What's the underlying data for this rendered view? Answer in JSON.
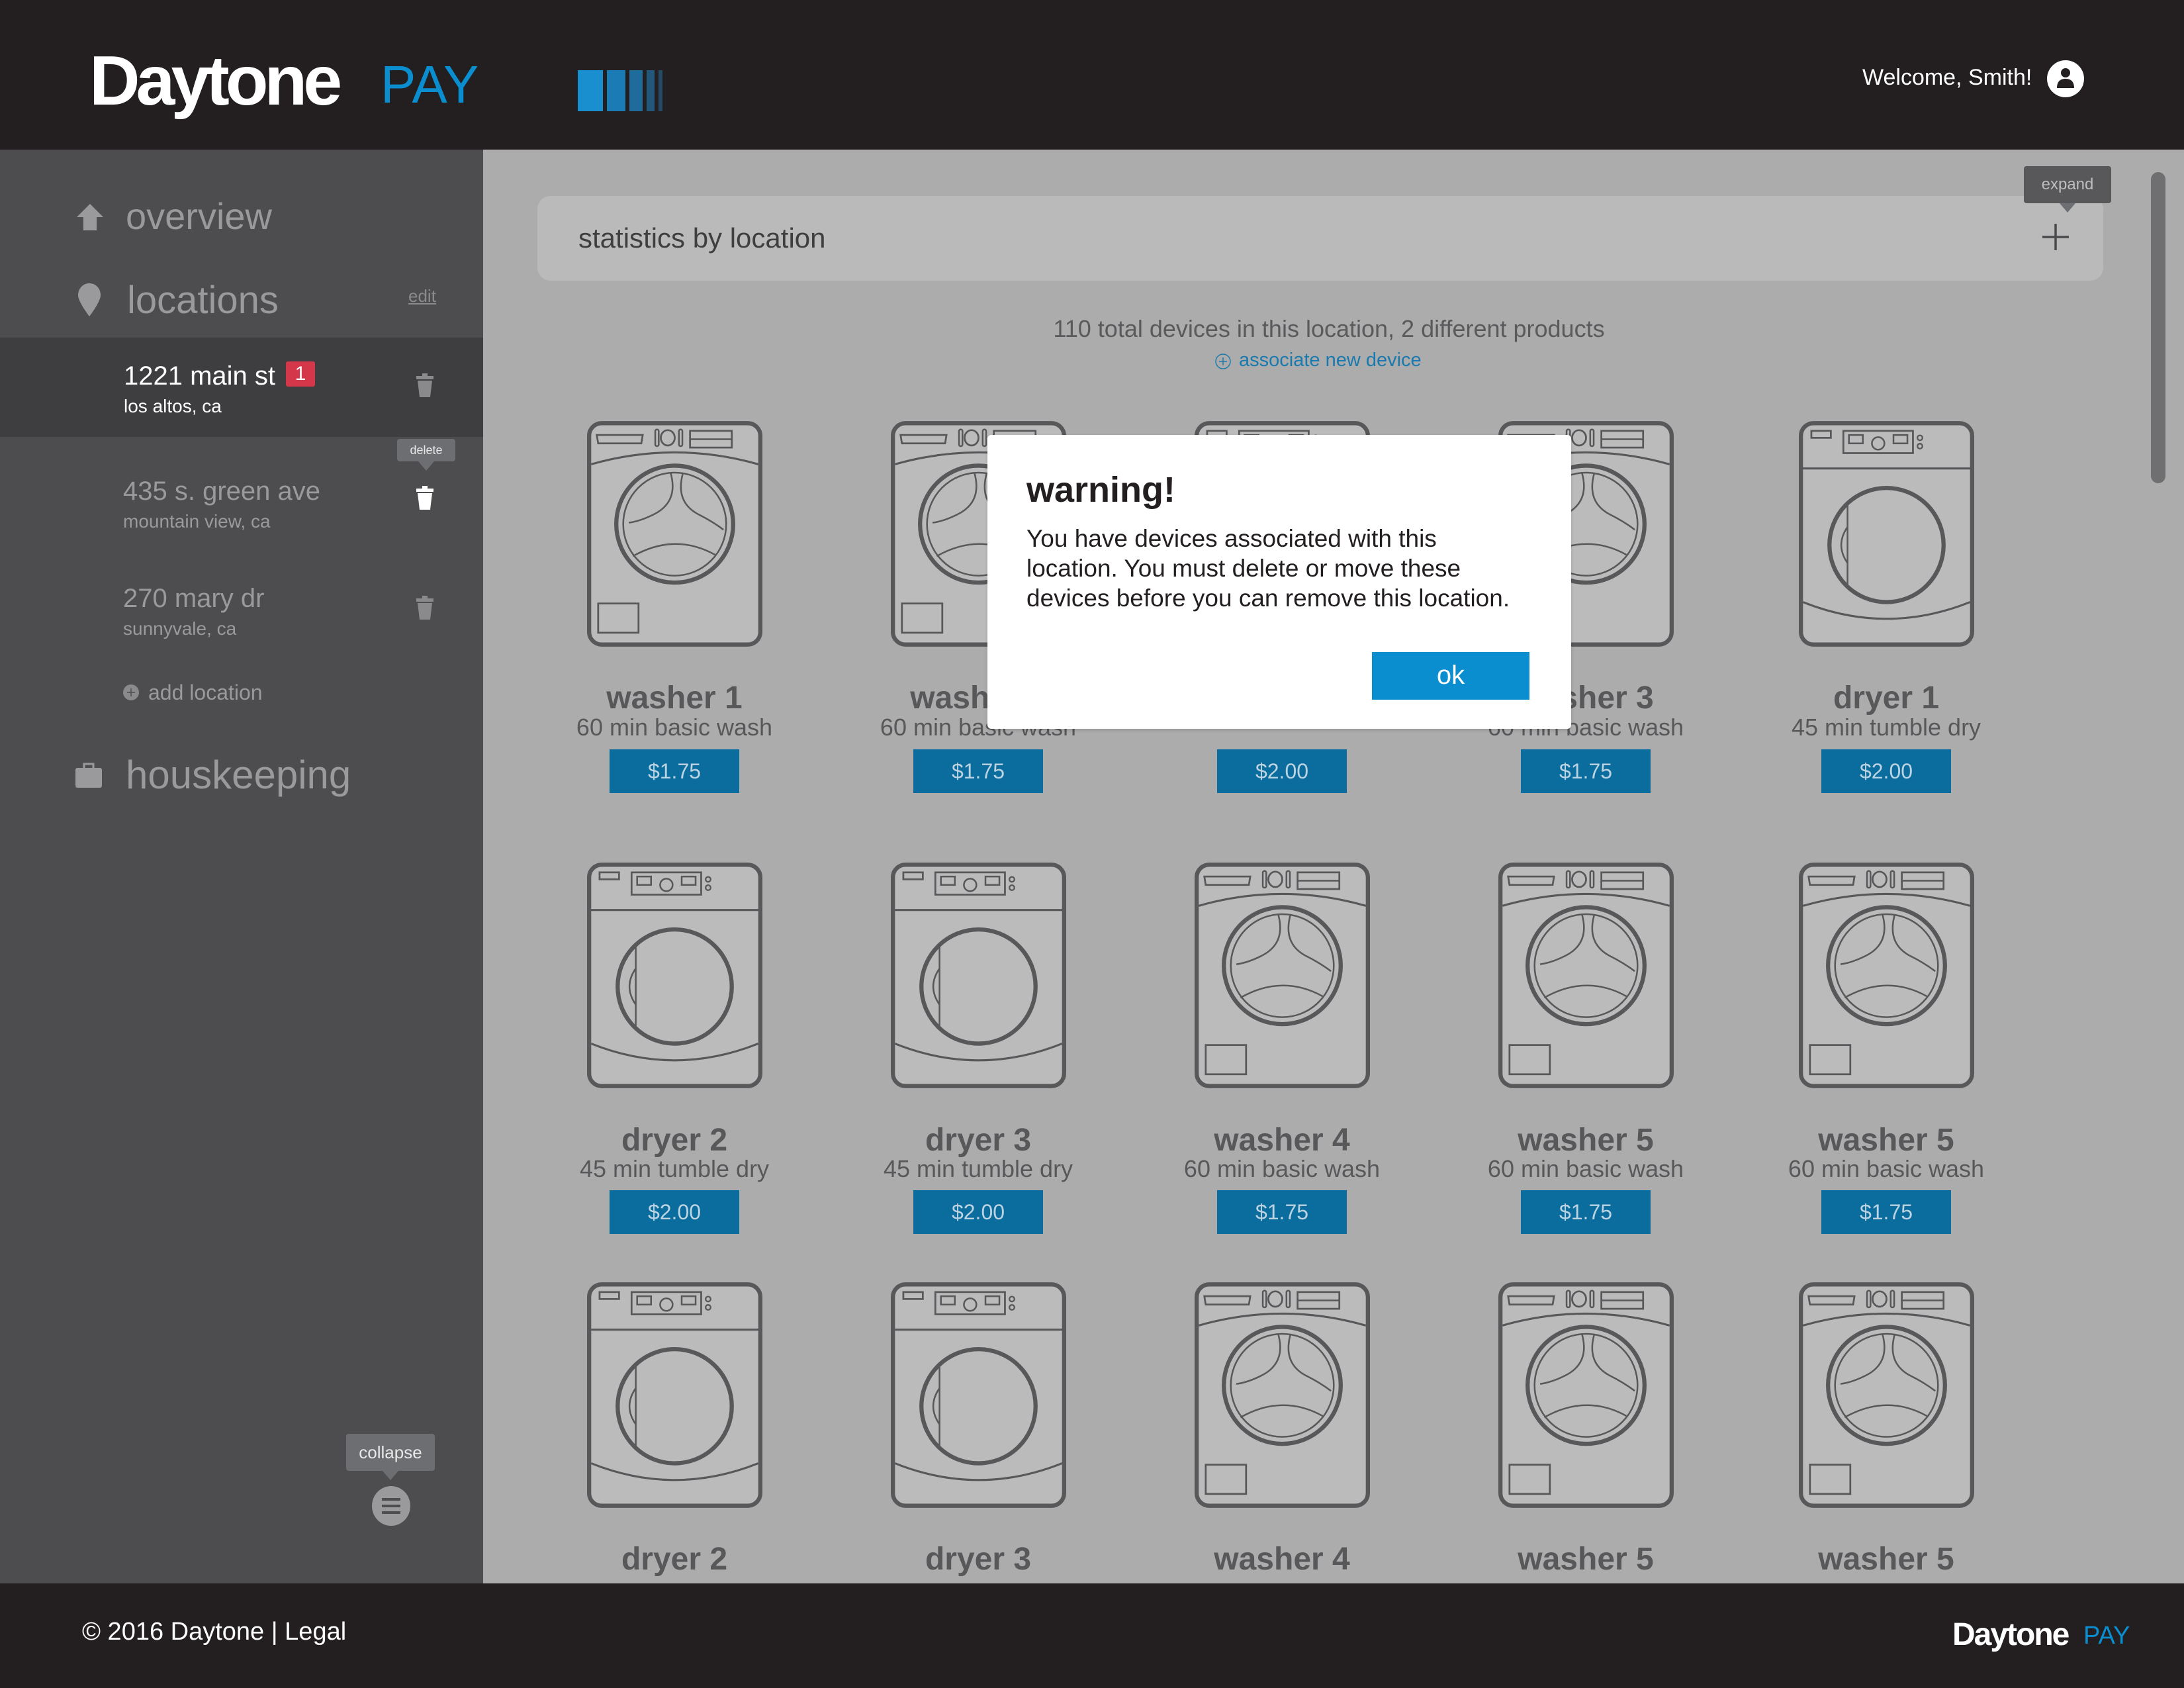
{
  "header": {
    "logo_word": "Daytone",
    "logo_pay": "PAY",
    "welcome": "Welcome, Smith!",
    "avatar_icon": "user-icon"
  },
  "sidebar": {
    "overview": "overview",
    "locations": "locations",
    "edit": "edit",
    "locations_list": [
      {
        "name": "1221 main st",
        "city": "los altos, ca",
        "badge": "1",
        "selected": true
      },
      {
        "name": "435 s. green ave",
        "city": "mountain view, ca",
        "tooltip": "delete"
      },
      {
        "name": "270 mary dr",
        "city": "sunnyvale, ca"
      }
    ],
    "add_location": "add location",
    "housekeeping": "houskeeping",
    "collapse_tooltip": "collapse"
  },
  "main": {
    "stats_title": "statistics by location",
    "expand_tooltip": "expand",
    "summary": "110 total devices in this location, 2 different products",
    "associate": "associate new device",
    "devices": [
      {
        "type": "washer",
        "name": "washer 1",
        "desc": "60 min basic wash",
        "price": "$1.75"
      },
      {
        "type": "washer",
        "name": "washer 2",
        "desc": "60 min basic wash",
        "price": "$1.75"
      },
      {
        "type": "dryer",
        "name": "",
        "desc": "",
        "price": "$2.00"
      },
      {
        "type": "washer",
        "name": "washer 3",
        "desc": "60 min basic wash",
        "price": "$1.75"
      },
      {
        "type": "dryer",
        "name": "dryer 1",
        "desc": "45 min tumble dry",
        "price": "$2.00"
      },
      {
        "type": "dryer",
        "name": "dryer 2",
        "desc": "45 min tumble dry",
        "price": "$2.00"
      },
      {
        "type": "dryer",
        "name": "dryer 3",
        "desc": "45 min tumble dry",
        "price": "$2.00"
      },
      {
        "type": "washer",
        "name": "washer 4",
        "desc": "60 min basic wash",
        "price": "$1.75"
      },
      {
        "type": "washer",
        "name": "washer 5",
        "desc": "60 min basic wash",
        "price": "$1.75"
      },
      {
        "type": "washer",
        "name": "washer 5",
        "desc": "60 min basic wash",
        "price": "$1.75"
      },
      {
        "type": "dryer",
        "name": "dryer 2"
      },
      {
        "type": "dryer",
        "name": "dryer 3"
      },
      {
        "type": "washer",
        "name": "washer 4"
      },
      {
        "type": "washer",
        "name": "washer 5"
      },
      {
        "type": "washer",
        "name": "washer 5"
      }
    ]
  },
  "dialog": {
    "title": "warning!",
    "line1": "You have devices associated with this",
    "line2": "location. You must delete or move these",
    "line3": "devices before you can remove this location.",
    "ok": "ok"
  },
  "footer": {
    "copyright": "© 2016 Daytone | Legal",
    "logo_word": "Daytone",
    "logo_pay": "PAY"
  },
  "colors": {
    "accent": "#0a8ed0",
    "price_button": "#0a6d9e",
    "badge": "#d4374a",
    "header_bg": "#231f20",
    "sidebar_bg": "#4d4d4f"
  }
}
